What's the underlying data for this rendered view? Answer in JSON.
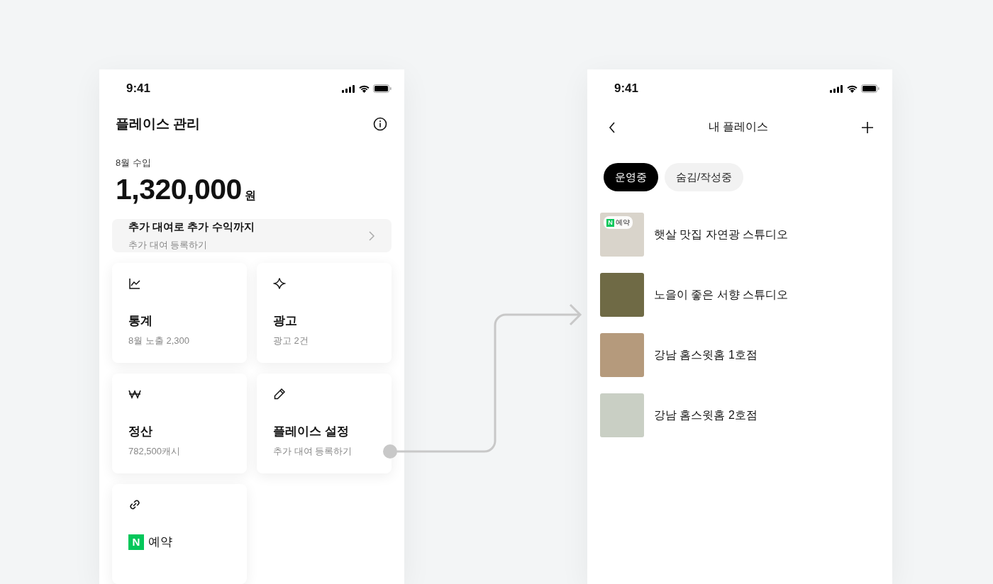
{
  "screens": [
    {
      "status_bar": {
        "time": "9:41"
      },
      "title": "플레이스 관리",
      "income": {
        "label": "8월 수입",
        "amount": "1,320,000",
        "unit": "원"
      },
      "banner": {
        "title": "추가 대여로 추가 수익까지",
        "subtitle": "추가 대여 등록하기"
      },
      "cards": [
        {
          "title": "통계",
          "subtitle": "8월 노출 2,300"
        },
        {
          "title": "광고",
          "subtitle": "광고 2건"
        },
        {
          "title": "정산",
          "subtitle": "782,500캐시"
        },
        {
          "title": "플레이스 설정",
          "subtitle": "추가 대여 등록하기"
        },
        {
          "logo": "N",
          "title": "예약"
        }
      ]
    },
    {
      "status_bar": {
        "time": "9:41"
      },
      "title": "내 플레이스",
      "chips": [
        {
          "label": "운영중",
          "selected": true
        },
        {
          "label": "숨김/작성중",
          "selected": false
        }
      ],
      "places": [
        {
          "name": "햇살 맛집 자연광 스튜디오",
          "badge": {
            "logo": "N",
            "label": "예약"
          }
        },
        {
          "name": "노을이 좋은 서향 스튜디오"
        },
        {
          "name": "강남 홈스윗홈 1호점"
        },
        {
          "name": "강남 홈스윗홈 2호점"
        }
      ]
    }
  ]
}
